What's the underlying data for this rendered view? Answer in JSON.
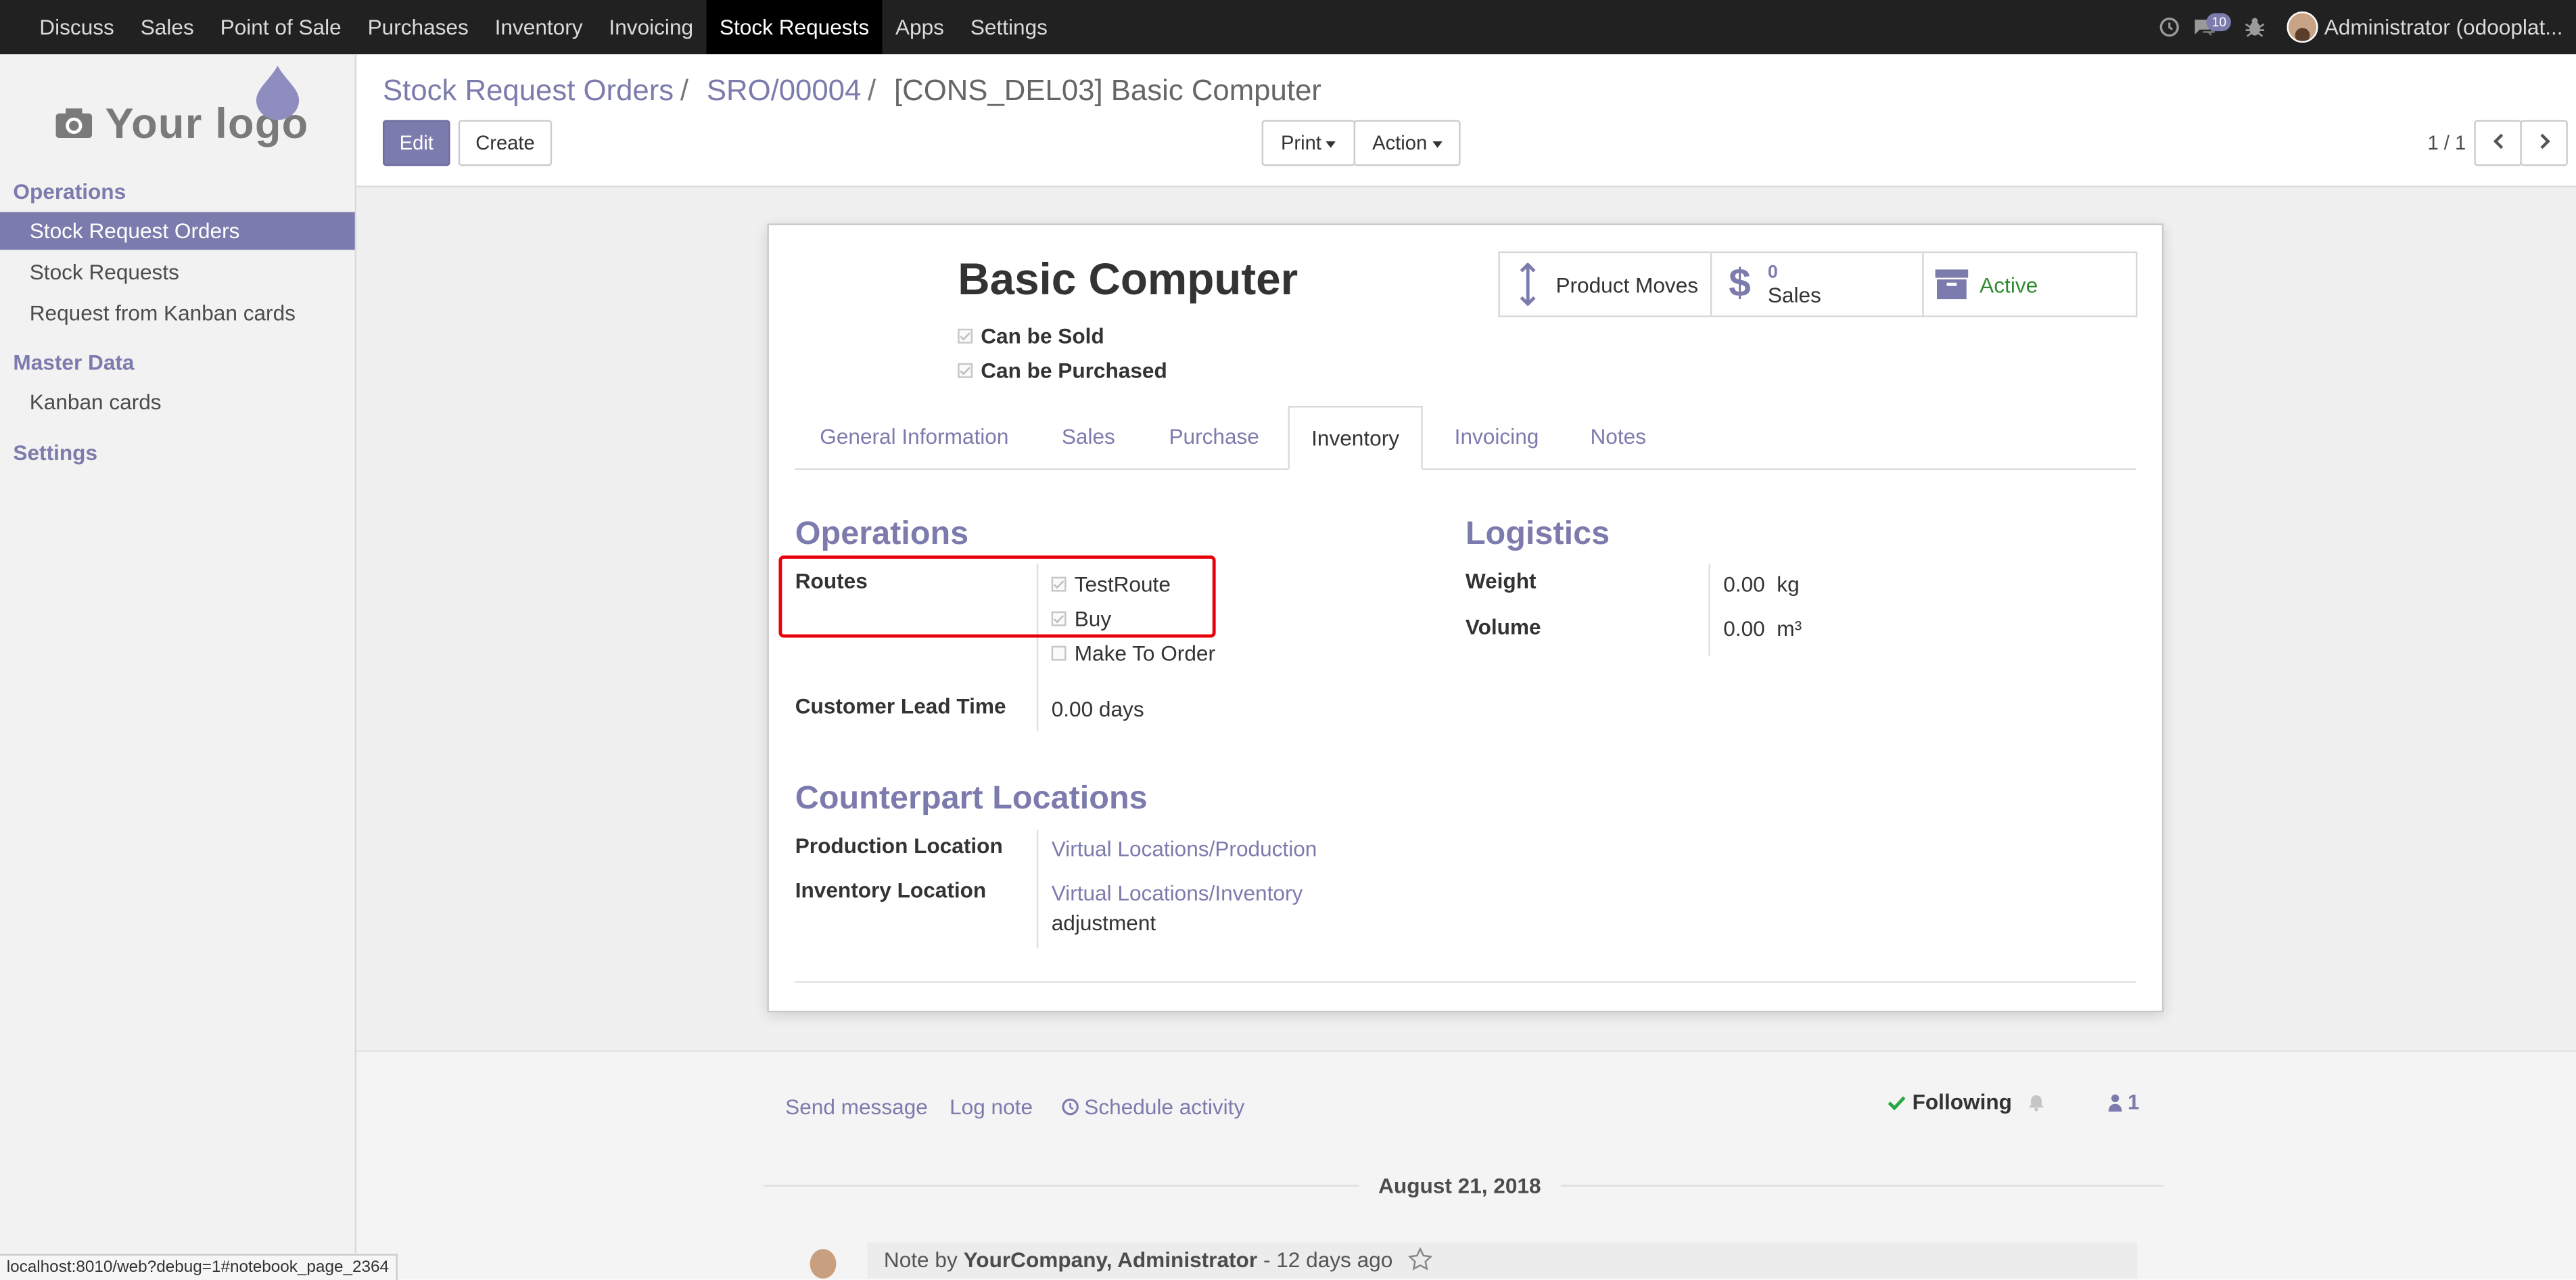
{
  "navbar": {
    "apps": [
      "Discuss",
      "Sales",
      "Point of Sale",
      "Purchases",
      "Inventory",
      "Invoicing",
      "Stock Requests",
      "Apps",
      "Settings"
    ],
    "active_app": "Stock Requests",
    "message_count": "10",
    "user": "Administrator (odooplat..."
  },
  "sidebar": {
    "logo_text": "Your logo",
    "sections": [
      {
        "title": "Operations",
        "items": [
          "Stock Request Orders",
          "Stock Requests",
          "Request from Kanban cards"
        ]
      },
      {
        "title": "Master Data",
        "items": [
          "Kanban cards"
        ]
      },
      {
        "title": "Settings",
        "items": []
      }
    ],
    "active_item": "Stock Request Orders"
  },
  "control_panel": {
    "breadcrumb": [
      "Stock Request Orders",
      "SRO/00004",
      "[CONS_DEL03] Basic Computer"
    ],
    "edit_label": "Edit",
    "create_label": "Create",
    "print_label": "Print",
    "action_label": "Action",
    "pager": "1 / 1"
  },
  "form": {
    "title": "Basic Computer",
    "can_be_sold": "Can be Sold",
    "can_be_purchased": "Can be Purchased",
    "stat_buttons": {
      "moves_label": "Product Moves",
      "sales_count": "0",
      "sales_label": "Sales",
      "active_label": "Active"
    },
    "tabs": [
      "General Information",
      "Sales",
      "Purchase",
      "Inventory",
      "Invoicing",
      "Notes"
    ],
    "active_tab": "Inventory",
    "operations": {
      "title": "Operations",
      "routes_label": "Routes",
      "routes": [
        {
          "name": "TestRoute",
          "checked": true
        },
        {
          "name": "Buy",
          "checked": true
        },
        {
          "name": "Make To Order",
          "checked": false
        }
      ],
      "lead_time_label": "Customer Lead Time",
      "lead_time_value": "0.00 days"
    },
    "logistics": {
      "title": "Logistics",
      "weight_label": "Weight",
      "weight_value": "0.00",
      "weight_unit": "kg",
      "volume_label": "Volume",
      "volume_value": "0.00",
      "volume_unit": "m³"
    },
    "counterpart": {
      "title": "Counterpart Locations",
      "production_label": "Production Location",
      "production_value": "Virtual Locations/Production",
      "inventory_label": "Inventory Location",
      "inventory_value": "Virtual Locations/Inventory",
      "inventory_value_suffix": "adjustment"
    }
  },
  "chatter": {
    "send_message": "Send message",
    "log_note": "Log note",
    "schedule_activity": "Schedule activity",
    "following": "Following",
    "followers_count": "1",
    "date": "August 21, 2018",
    "note_prefix": "Note by",
    "note_author": "YourCompany, Administrator",
    "note_time": "- 12 days ago"
  },
  "status_url": "localhost:8010/web?debug=1#notebook_page_2364",
  "colors": {
    "accent": "#7c7bad",
    "navbar": "#212121",
    "active_green": "#2f8b2f",
    "highlight_red": "#e8000b"
  }
}
